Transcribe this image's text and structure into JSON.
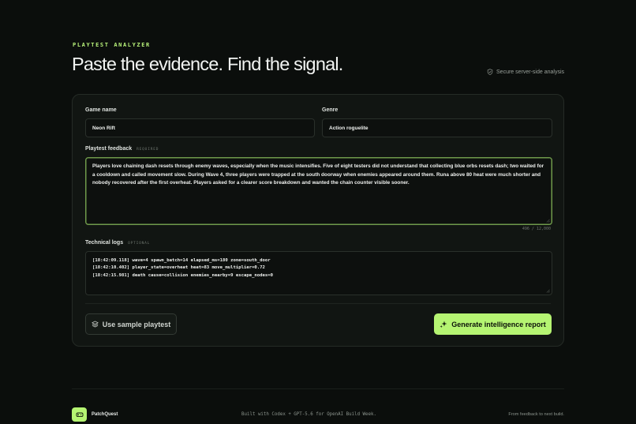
{
  "header": {
    "eyebrow": "PLAYTEST ANALYZER",
    "title": "Paste the evidence. Find the signal.",
    "secure_note": "Secure server-side analysis",
    "secure_icon": "shield-check-icon"
  },
  "form": {
    "game_name": {
      "label": "Game name",
      "value": "Neon Rift"
    },
    "genre": {
      "label": "Genre",
      "value": "Action roguelite"
    },
    "feedback": {
      "label": "Playtest feedback",
      "tag": "REQUIRED",
      "value": "Players love chaining dash resets through enemy waves, especially when the music intensifies. Five of eight testers did not understand that collecting blue orbs resets dash; two waited for a cooldown and called movement slow. During Wave 4, three players were trapped at the south doorway when enemies appeared around them. Runa above 80 heat were much shorter and nobody recovered after the first overheat. Players asked for a clearer score breakdown and wanted the chain counter visible sooner.",
      "counter": "496 / 12,000"
    },
    "logs": {
      "label": "Technical logs",
      "tag": "OPTIONAL",
      "lines": [
        "[18:42:09.118] wave=4 spawn_batch=14 elapsed_ms=180 zone=south_door",
        "[18:42:10.402] player_state=overheat heat=83 move_multiplier=0.72",
        "[18:42:15.981] death cause=collision enemies_nearby=9 escape_nodes=0"
      ]
    }
  },
  "actions": {
    "sample_label": "Use sample playtest",
    "sample_icon": "layers-icon",
    "generate_label": "Generate intelligence report",
    "generate_icon": "sparkles-icon"
  },
  "footer": {
    "brand": "PatchQuest",
    "brand_icon": "gamepad-icon",
    "built": "Built with Codex + GPT-5.6 for OpenAI Build Week.",
    "tagline": "From feedback to next build."
  },
  "colors": {
    "accent": "#b5f472",
    "background": "#0b0e0c",
    "card": "#111512"
  }
}
